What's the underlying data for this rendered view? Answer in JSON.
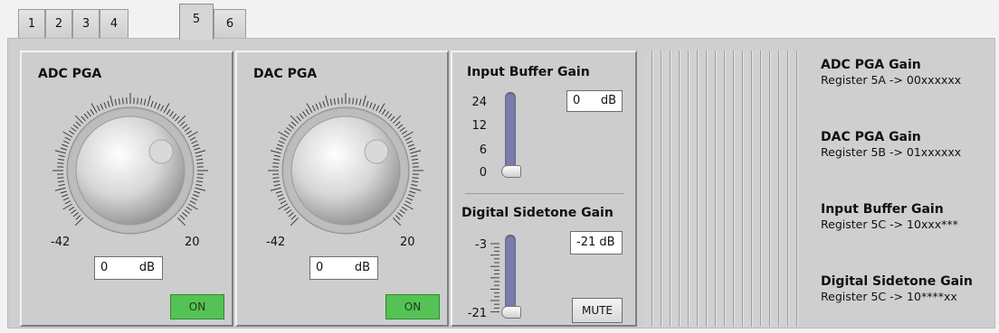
{
  "tabs": [
    {
      "label": "1"
    },
    {
      "label": "2"
    },
    {
      "label": "3"
    },
    {
      "label": "4"
    },
    {
      "label": "5"
    },
    {
      "label": "6"
    }
  ],
  "active_tab": "5",
  "adc_pga": {
    "title": "ADC PGA",
    "scale_min": "-42",
    "scale_max": "20",
    "value": "0",
    "unit": "dB",
    "on_label": "ON"
  },
  "dac_pga": {
    "title": "DAC PGA",
    "scale_min": "-42",
    "scale_max": "20",
    "value": "0",
    "unit": "dB",
    "on_label": "ON"
  },
  "input_buffer": {
    "title": "Input Buffer Gain",
    "ticks": [
      "24",
      "12",
      "6",
      "0"
    ],
    "value": "0",
    "unit": "dB",
    "level": 0
  },
  "digital_sidetone": {
    "title": "Digital Sidetone Gain",
    "ticks": [
      "-3",
      "-21"
    ],
    "value": "-21 dB",
    "level": 0,
    "mute_label": "MUTE"
  },
  "register_info": [
    {
      "title": "ADC PGA Gain",
      "register": "Register 5A -> 00xxxxxx"
    },
    {
      "title": "DAC PGA Gain",
      "register": "Register 5B -> 01xxxxxx"
    },
    {
      "title": "Input Buffer Gain",
      "register": "Register 5C -> 10xxx***"
    },
    {
      "title": "Digital Sidetone Gain",
      "register": "Register 5C -> 10****xx"
    }
  ],
  "colors": {
    "on_button": "#55c255",
    "slider_track": "#7a7da8"
  },
  "icons": {
    "knob": "rotary-knob-icon",
    "slider": "vertical-slider-icon"
  }
}
